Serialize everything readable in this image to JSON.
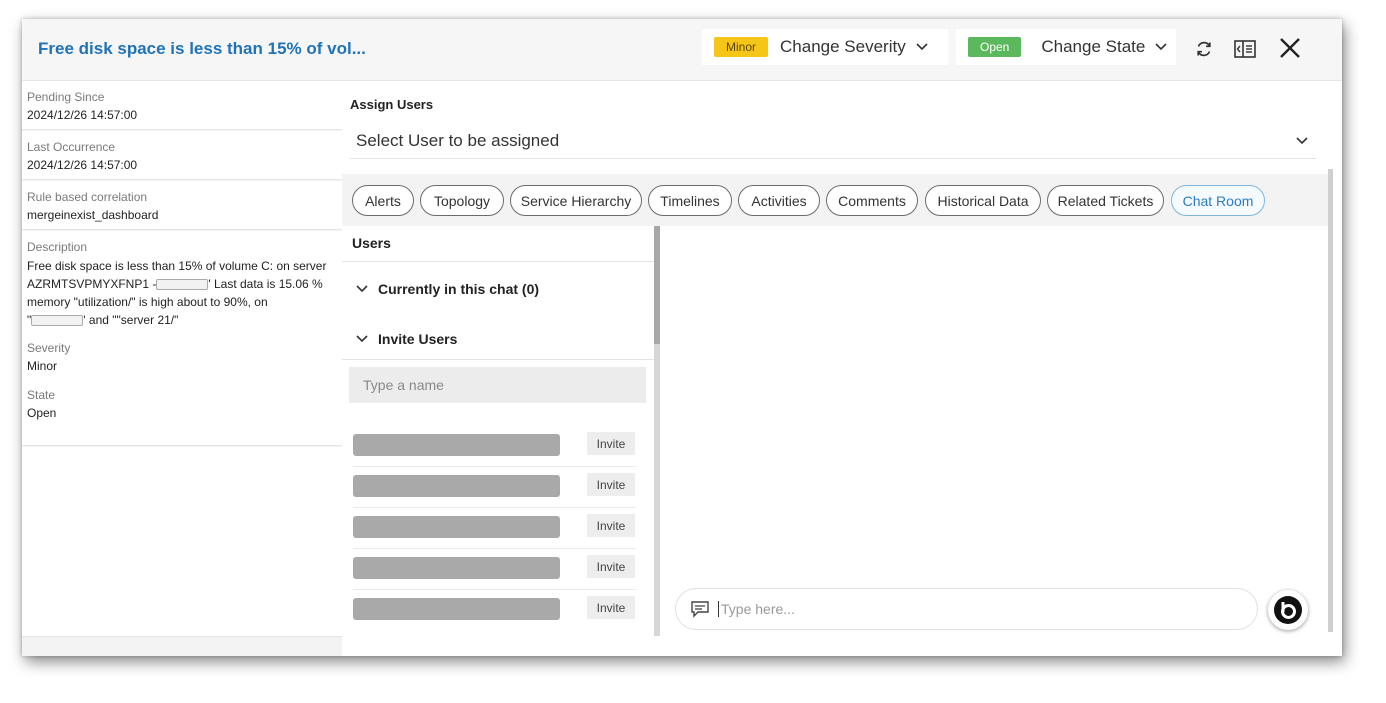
{
  "header": {
    "title": "Free disk space is less than 15% of vol...",
    "severity_badge": "Minor",
    "change_severity": "Change Severity",
    "state_badge": "Open",
    "change_state": "Change State"
  },
  "details": {
    "pending_since_label": "Pending Since",
    "pending_since_value": "2024/12/26 14:57:00",
    "last_occurrence_label": "Last Occurrence",
    "last_occurrence_value": "2024/12/26 14:57:00",
    "rule_label": "Rule based correlation",
    "rule_value": "mergeinexist_dashboard",
    "description_label": "Description",
    "description_line1": "Free disk space is less than 15% of volume C: on server",
    "description_line2a": "AZRMTSVPMYXFNP1 -",
    "description_line2b": "' Last data is 15.06 %",
    "description_line3": "memory \"utilization/\" is high about to 90%, on",
    "description_line4a": "\"",
    "description_line4b": "' and \"\"server 21/\"",
    "severity_label": "Severity",
    "severity_value": "Minor",
    "state_label": "State",
    "state_value": "Open"
  },
  "assign": {
    "title": "Assign Users",
    "placeholder": "Select User to be assigned"
  },
  "tabs": [
    {
      "label": "Alerts"
    },
    {
      "label": "Topology"
    },
    {
      "label": "Service Hierarchy"
    },
    {
      "label": "Timelines"
    },
    {
      "label": "Activities"
    },
    {
      "label": "Comments"
    },
    {
      "label": "Historical Data"
    },
    {
      "label": "Related Tickets"
    },
    {
      "label": "Chat Room"
    }
  ],
  "active_tab": "Chat Room",
  "users": {
    "title": "Users",
    "currently_in_chat": "Currently in this chat (0)",
    "invite_users": "Invite Users",
    "name_placeholder": "Type a name",
    "invite_label": "Invite"
  },
  "chat": {
    "placeholder": "Type here..."
  },
  "colors": {
    "title_blue": "#1f73b7",
    "minor_badge": "#f5c518",
    "open_badge": "#5cb85c",
    "active_tab_border": "#7fb6dd"
  }
}
